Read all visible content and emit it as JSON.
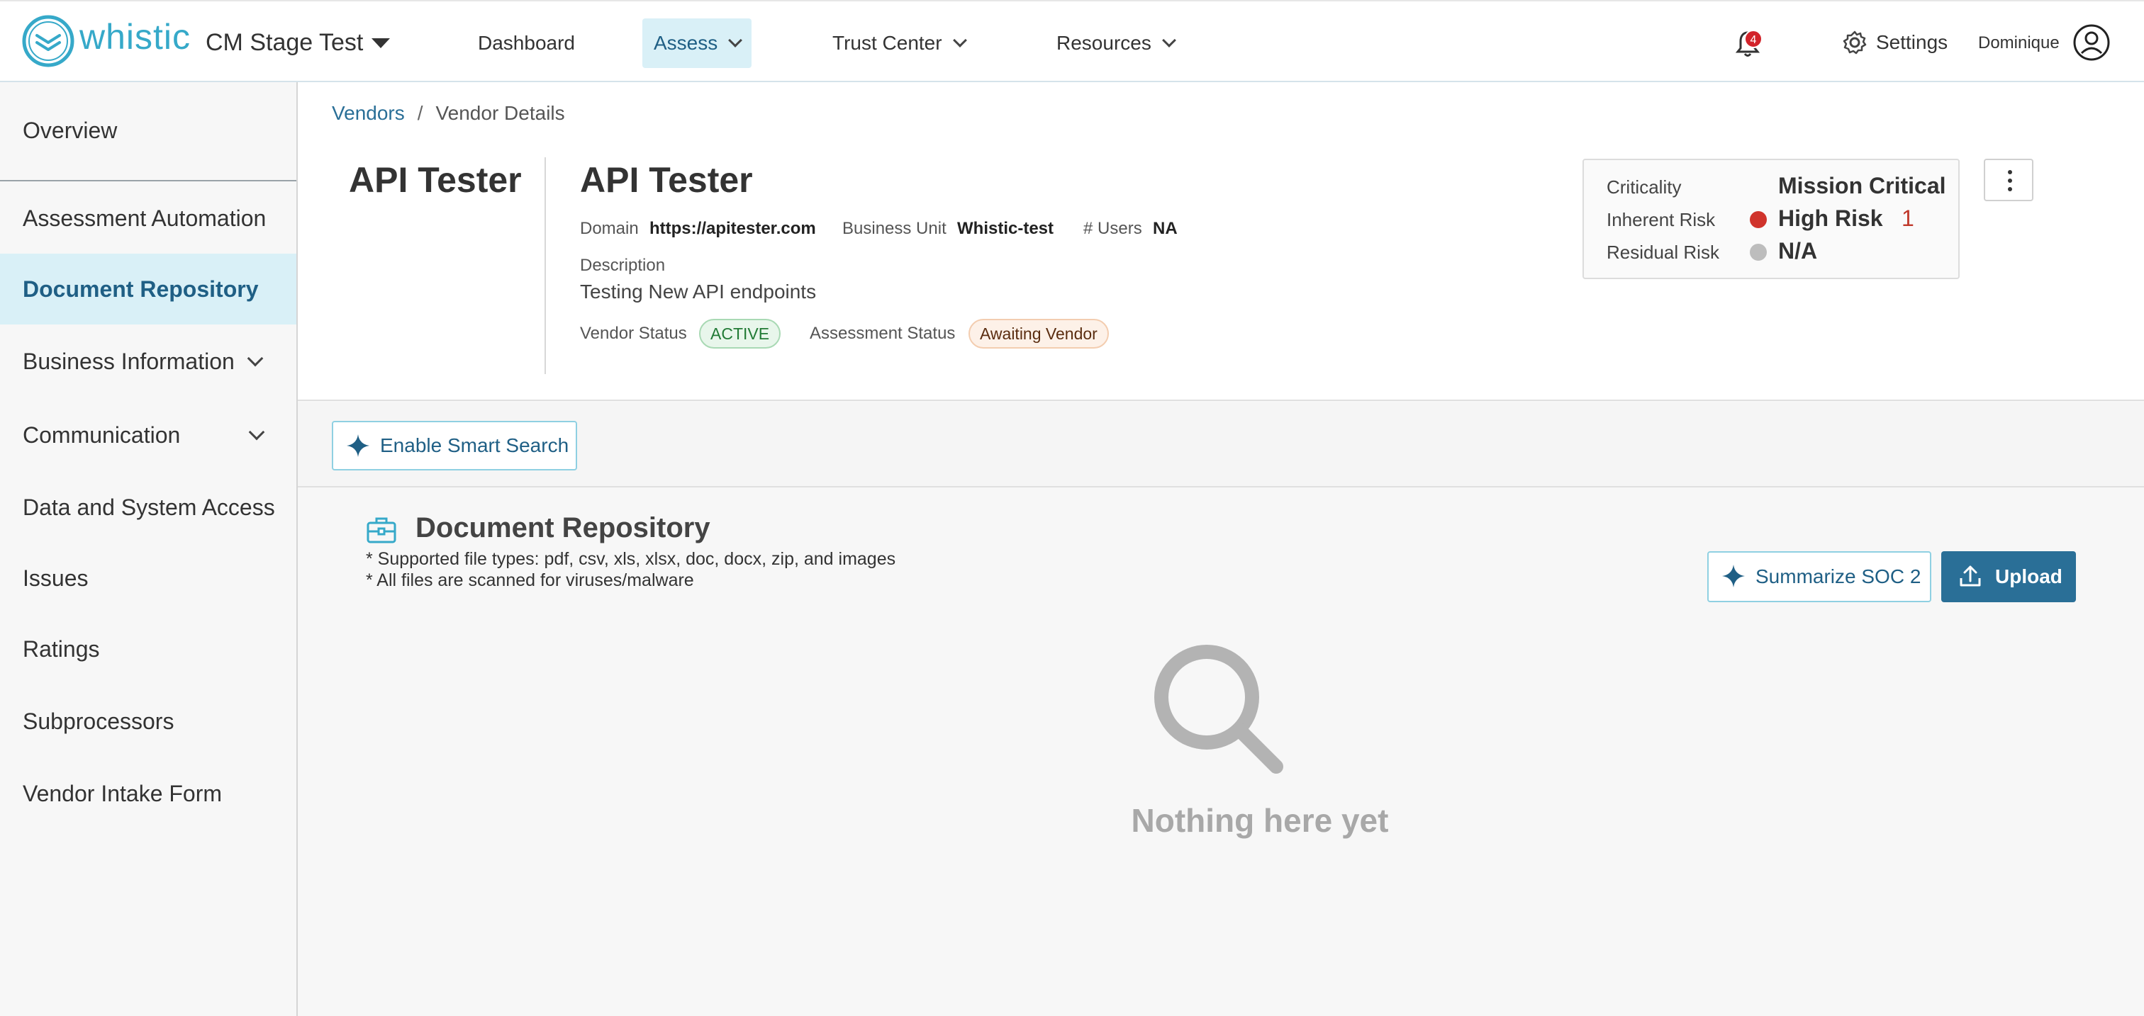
{
  "brand": {
    "logo_text": "whistic",
    "accent": "#36a9c9"
  },
  "org": {
    "name": "CM Stage Test"
  },
  "nav": {
    "dashboard": "Dashboard",
    "assess": "Assess",
    "trust_center": "Trust Center",
    "resources": "Resources"
  },
  "notifications": {
    "count": "4"
  },
  "settings_label": "Settings",
  "user": {
    "name": "Dominique"
  },
  "sidebar": {
    "items": [
      {
        "label": "Overview"
      },
      {
        "label": "Assessment Automation"
      },
      {
        "label": "Document Repository"
      },
      {
        "label": "Business Information"
      },
      {
        "label": "Communication"
      },
      {
        "label": "Data and System Access"
      },
      {
        "label": "Issues"
      },
      {
        "label": "Ratings"
      },
      {
        "label": "Subprocessors"
      },
      {
        "label": "Vendor Intake Form"
      }
    ]
  },
  "breadcrumb": {
    "parent": "Vendors",
    "separator": "/",
    "current": "Vendor Details"
  },
  "vendor": {
    "logo_name": "API Tester",
    "name": "API Tester",
    "domain_label": "Domain",
    "domain": "https://apitester.com",
    "business_unit_label": "Business Unit",
    "business_unit": "Whistic-test",
    "users_label": "# Users",
    "users": "NA",
    "description_label": "Description",
    "description": "Testing New API endpoints",
    "vendor_status_label": "Vendor Status",
    "vendor_status": "ACTIVE",
    "assessment_status_label": "Assessment Status",
    "assessment_status": "Awaiting Vendor"
  },
  "risk": {
    "criticality_label": "Criticality",
    "criticality": "Mission Critical",
    "inherent_label": "Inherent Risk",
    "inherent": "High Risk",
    "inherent_count": "1",
    "inherent_color": "#d0342c",
    "residual_label": "Residual Risk",
    "residual": "N/A",
    "residual_color": "#bdbdbd"
  },
  "toolbar": {
    "smart_search": "Enable Smart Search"
  },
  "repository": {
    "title": "Document Repository",
    "note_1": "* Supported file types: pdf, csv, xls, xlsx, doc, docx, zip, and images",
    "note_2": "* All files are scanned for viruses/malware",
    "summarize_button": "Summarize SOC 2",
    "upload_button": "Upload",
    "empty_text": "Nothing here yet"
  }
}
